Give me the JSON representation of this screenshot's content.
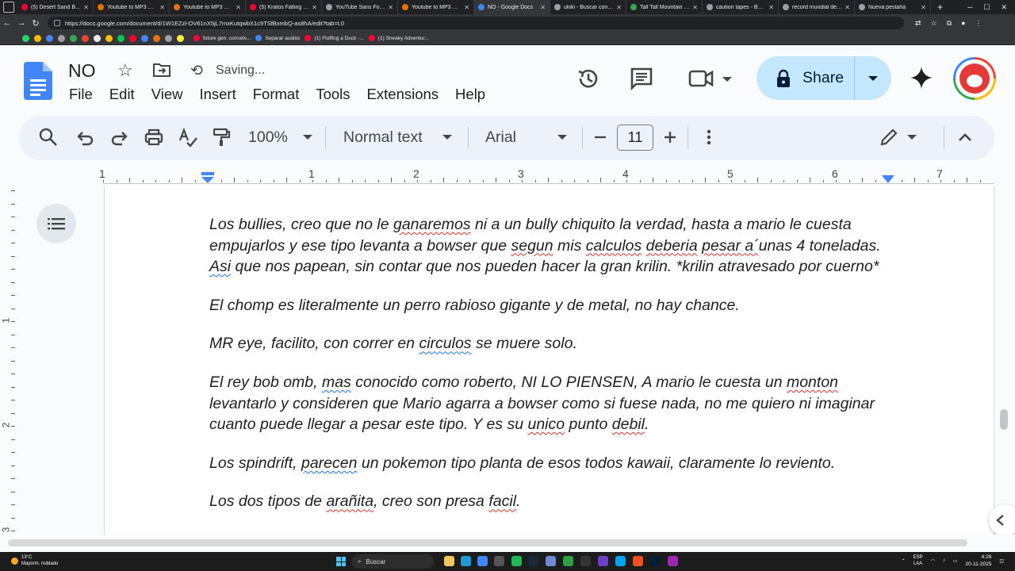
{
  "browser": {
    "tabs": [
      {
        "title": "(5) Desert Sand Blow...",
        "color": "#ff0033"
      },
      {
        "title": "Youtube to MP3 Conv...",
        "color": "#e8710a"
      },
      {
        "title": "Youtube to MP3 Conv...",
        "color": "#e8710a"
      },
      {
        "title": "(5) Kratos Falling to...",
        "color": "#ff0033"
      },
      {
        "title": "YouTube Sans Font F...",
        "color": "#9aa0a6"
      },
      {
        "title": "Youtube to MP3 Conv...",
        "color": "#e8710a"
      },
      {
        "title": "NO - Google Docs",
        "color": "#4285f4",
        "active": true
      },
      {
        "title": "ukiki - Buscar con Go...",
        "color": "#9aa0a6"
      },
      {
        "title": "Tall Tall Mountain - S...",
        "color": "#34a853"
      },
      {
        "title": "caution tapes - Busc...",
        "color": "#9aa0a6"
      },
      {
        "title": "record mundial de s...",
        "color": "#9aa0a6"
      },
      {
        "title": "Nueva pestaña",
        "color": "#9aa0a6"
      }
    ],
    "url": "https://docs.google.com/document/d/1W1EZzl-OV61nX5jL7mxKutqwbX1c9TSfBxmbQ-as8hA/edit?tab=t.0",
    "bookmarks": [
      {
        "title": "future gen. consels...",
        "color": "#ff0033"
      },
      {
        "title": "Separar audios",
        "color": "#4285f4"
      },
      {
        "title": "(1) Fluffing a Duck -...",
        "color": "#ff0033"
      },
      {
        "title": "(1) Sneaky Adventur...",
        "color": "#ff0033"
      }
    ]
  },
  "doc": {
    "title": "NO",
    "save_status": "Saving...",
    "menus": [
      "File",
      "Edit",
      "View",
      "Insert",
      "Format",
      "Tools",
      "Extensions",
      "Help"
    ],
    "share_label": "Share"
  },
  "toolbar": {
    "zoom": "100%",
    "style": "Normal text",
    "font": "Arial",
    "font_size": "11"
  },
  "ruler": {
    "labels": [
      "1",
      "1",
      "2",
      "3",
      "4",
      "5",
      "6",
      "7"
    ],
    "vertical_labels": [
      "1",
      "2",
      "3"
    ]
  },
  "body": {
    "paragraphs": [
      [
        {
          "t": "Los bullies, creo que no le "
        },
        {
          "t": "ganaremos",
          "u": "spell"
        },
        {
          "t": " ni a un bully chiquito la verdad, hasta a mario le cuesta empujarlos y ese tipo levanta a bowser que "
        },
        {
          "t": "segun",
          "u": "spell"
        },
        {
          "t": " mis "
        },
        {
          "t": "calculos",
          "u": "spell"
        },
        {
          "t": " "
        },
        {
          "t": "deberia",
          "u": "spell"
        },
        {
          "t": " "
        },
        {
          "t": "pesar a´",
          "u": "spell"
        },
        {
          "t": "unas 4 toneladas. "
        },
        {
          "t": "Asi",
          "u": "gram"
        },
        {
          "t": " que nos papean, sin contar que nos pueden hacer la gran krilin. *krilin atravesado por cuerno*"
        }
      ],
      [
        {
          "t": "El chomp es literalmente un perro rabioso gigante y de metal, no hay chance."
        }
      ],
      [
        {
          "t": "MR eye, facilito, con correr en "
        },
        {
          "t": "circulos",
          "u": "gram"
        },
        {
          "t": " se muere solo."
        }
      ],
      [
        {
          "t": "El rey bob omb, "
        },
        {
          "t": "mas",
          "u": "gram"
        },
        {
          "t": " conocido como roberto, NI LO PIENSEN, A mario le cuesta un "
        },
        {
          "t": "monton",
          "u": "spell"
        },
        {
          "t": " levantarlo y consideren que Mario agarra a bowser como si fuese nada, no me quiero ni imaginar cuanto puede llegar a pesar este tipo. Y es su "
        },
        {
          "t": "unico",
          "u": "spell"
        },
        {
          "t": " punto "
        },
        {
          "t": "debil",
          "u": "spell"
        },
        {
          "t": "."
        }
      ],
      [
        {
          "t": "Los spindrift, "
        },
        {
          "t": "parecen",
          "u": "gram"
        },
        {
          "t": " un pokemon tipo planta de esos todos kawaii, claramente lo reviento."
        }
      ],
      [
        {
          "t": "Los dos tipos de "
        },
        {
          "t": "arañita",
          "u": "spell"
        },
        {
          "t": ", creo son presa "
        },
        {
          "t": "facil",
          "u": "spell"
        },
        {
          "t": "."
        }
      ]
    ]
  },
  "taskbar": {
    "temperature": "13°C",
    "weather": "Mayorm. nublado",
    "search_placeholder": "Buscar",
    "lang_top": "ESP",
    "lang_bottom": "LAA",
    "time": "4:26",
    "date": "20-11-2025"
  },
  "colors": {
    "docs_blue": "#4285f4",
    "share_bg": "#c2e7ff",
    "spell_error": "#d93025",
    "grammar_error": "#1a73e8"
  }
}
